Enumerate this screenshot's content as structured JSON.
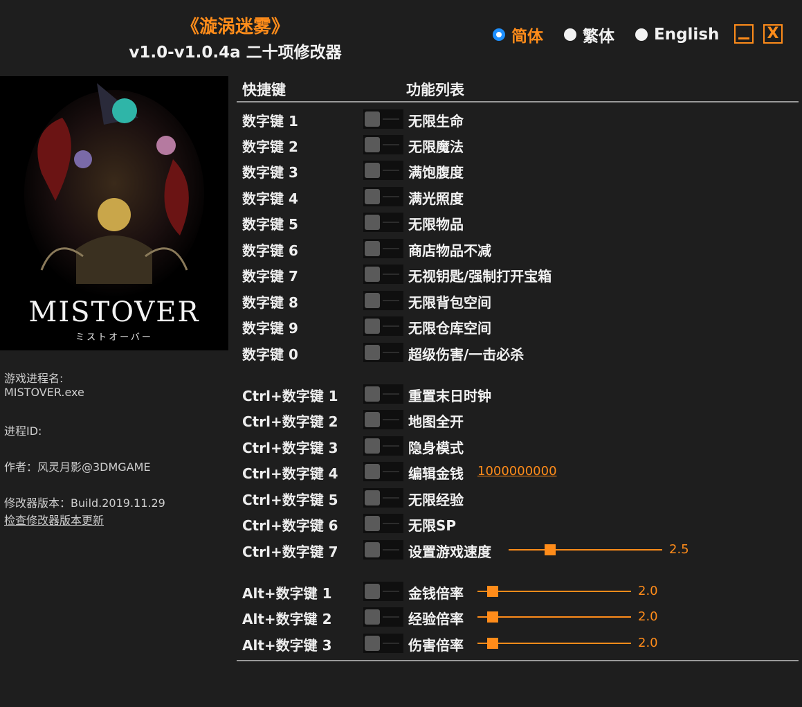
{
  "header": {
    "title": "《漩涡迷雾》",
    "subtitle": "v1.0-v1.0.4a 二十项修改器"
  },
  "languages": [
    {
      "label": "简体",
      "selected": true
    },
    {
      "label": "繁体",
      "selected": false
    },
    {
      "label": "English",
      "selected": false
    }
  ],
  "window": {
    "close_label": "X"
  },
  "cover": {
    "title": "MISTOVER",
    "subtitle": "ミストオーバー"
  },
  "info": {
    "process_label": "游戏进程名:",
    "process_name": "MISTOVER.exe",
    "pid_label": "进程ID:",
    "author": "作者：风灵月影@3DMGAME",
    "version": "修改器版本：Build.2019.11.29",
    "check_update": "检查修改器版本更新"
  },
  "columns": {
    "hotkey": "快捷键",
    "functions": "功能列表"
  },
  "cheats": [
    {
      "key": "数字键 1",
      "name": "无限生命"
    },
    {
      "key": "数字键 2",
      "name": "无限魔法"
    },
    {
      "key": "数字键 3",
      "name": "满饱腹度"
    },
    {
      "key": "数字键 4",
      "name": "满光照度"
    },
    {
      "key": "数字键 5",
      "name": "无限物品"
    },
    {
      "key": "数字键 6",
      "name": "商店物品不减"
    },
    {
      "key": "数字键 7",
      "name": "无视钥匙/强制打开宝箱"
    },
    {
      "key": "数字键 8",
      "name": "无限背包空间"
    },
    {
      "key": "数字键 9",
      "name": "无限仓库空间"
    },
    {
      "key": "数字键 0",
      "name": "超级伤害/一击必杀"
    },
    {
      "key": "Ctrl+数字键 1",
      "name": "重置末日时钟"
    },
    {
      "key": "Ctrl+数字键 2",
      "name": "地图全开"
    },
    {
      "key": "Ctrl+数字键 3",
      "name": "隐身模式"
    },
    {
      "key": "Ctrl+数字键 4",
      "name": "编辑金钱",
      "value": "1000000000"
    },
    {
      "key": "Ctrl+数字键 5",
      "name": "无限经验"
    },
    {
      "key": "Ctrl+数字键 6",
      "name": "无限SP"
    },
    {
      "key": "Ctrl+数字键 7",
      "name": "设置游戏速度",
      "slider": {
        "value": "2.5",
        "fraction": 0.27
      }
    },
    {
      "key": "Alt+数字键 1",
      "name": "金钱倍率",
      "slider": {
        "value": "2.0",
        "fraction": 0.1
      }
    },
    {
      "key": "Alt+数字键 2",
      "name": "经验倍率",
      "slider": {
        "value": "2.0",
        "fraction": 0.1
      }
    },
    {
      "key": "Alt+数字键 3",
      "name": "伤害倍率",
      "slider": {
        "value": "2.0",
        "fraction": 0.1
      }
    }
  ]
}
